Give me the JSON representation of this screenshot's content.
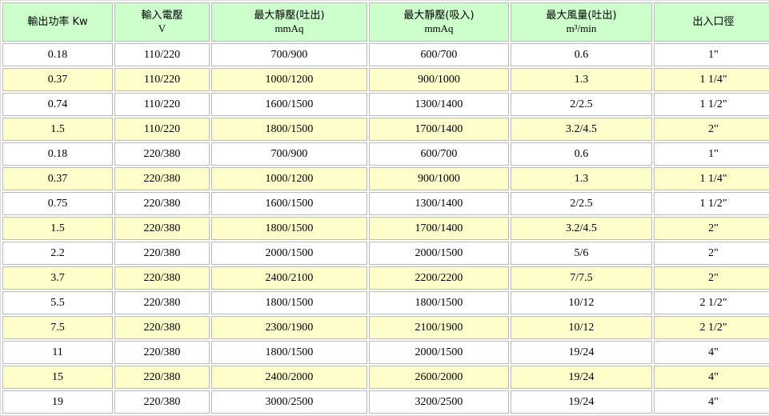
{
  "columns": [
    {
      "label": "輸出功率 Kw",
      "unit": ""
    },
    {
      "label": "輸入電壓",
      "unit": "V"
    },
    {
      "label": "最大靜壓(吐出)",
      "unit": "mmAq"
    },
    {
      "label": "最大靜壓(吸入)",
      "unit": "mmAq"
    },
    {
      "label": "最大風量(吐出)",
      "unit": "m³/min"
    },
    {
      "label": "出入口徑",
      "unit": ""
    }
  ],
  "rows": [
    [
      "0.18",
      "110/220",
      "700/900",
      "600/700",
      "0.6",
      "1\""
    ],
    [
      "0.37",
      "110/220",
      "1000/1200",
      "900/1000",
      "1.3",
      "1 1/4\""
    ],
    [
      "0.74",
      "110/220",
      "1600/1500",
      "1300/1400",
      "2/2.5",
      "1 1/2\""
    ],
    [
      "1.5",
      "110/220",
      "1800/1500",
      "1700/1400",
      "3.2/4.5",
      "2\""
    ],
    [
      "0.18",
      "220/380",
      "700/900",
      "600/700",
      "0.6",
      "1\""
    ],
    [
      "0.37",
      "220/380",
      "1000/1200",
      "900/1000",
      "1.3",
      "1 1/4\""
    ],
    [
      "0.75",
      "220/380",
      "1600/1500",
      "1300/1400",
      "2/2.5",
      "1 1/2\""
    ],
    [
      "1.5",
      "220/380",
      "1800/1500",
      "1700/1400",
      "3.2/4.5",
      "2\""
    ],
    [
      "2.2",
      "220/380",
      "2000/1500",
      "2000/1500",
      "5/6",
      "2\""
    ],
    [
      "3.7",
      "220/380",
      "2400/2100",
      "2200/2200",
      "7/7.5",
      "2\""
    ],
    [
      "5.5",
      "220/380",
      "1800/1500",
      "1800/1500",
      "10/12",
      "2 1/2\""
    ],
    [
      "7.5",
      "220/380",
      "2300/1900",
      "2100/1900",
      "10/12",
      "2 1/2\""
    ],
    [
      "11",
      "220/380",
      "1800/1500",
      "2000/1500",
      "19/24",
      "4\""
    ],
    [
      "15",
      "220/380",
      "2400/2000",
      "2600/2000",
      "19/24",
      "4\""
    ],
    [
      "19",
      "220/380",
      "3000/2500",
      "3200/2500",
      "19/24",
      "4\""
    ]
  ],
  "colors": {
    "header_bg": "#ccffcc",
    "row_odd_bg": "#ffffff",
    "row_even_bg": "#ffffcc",
    "cell_border": "#b9b9b9"
  }
}
